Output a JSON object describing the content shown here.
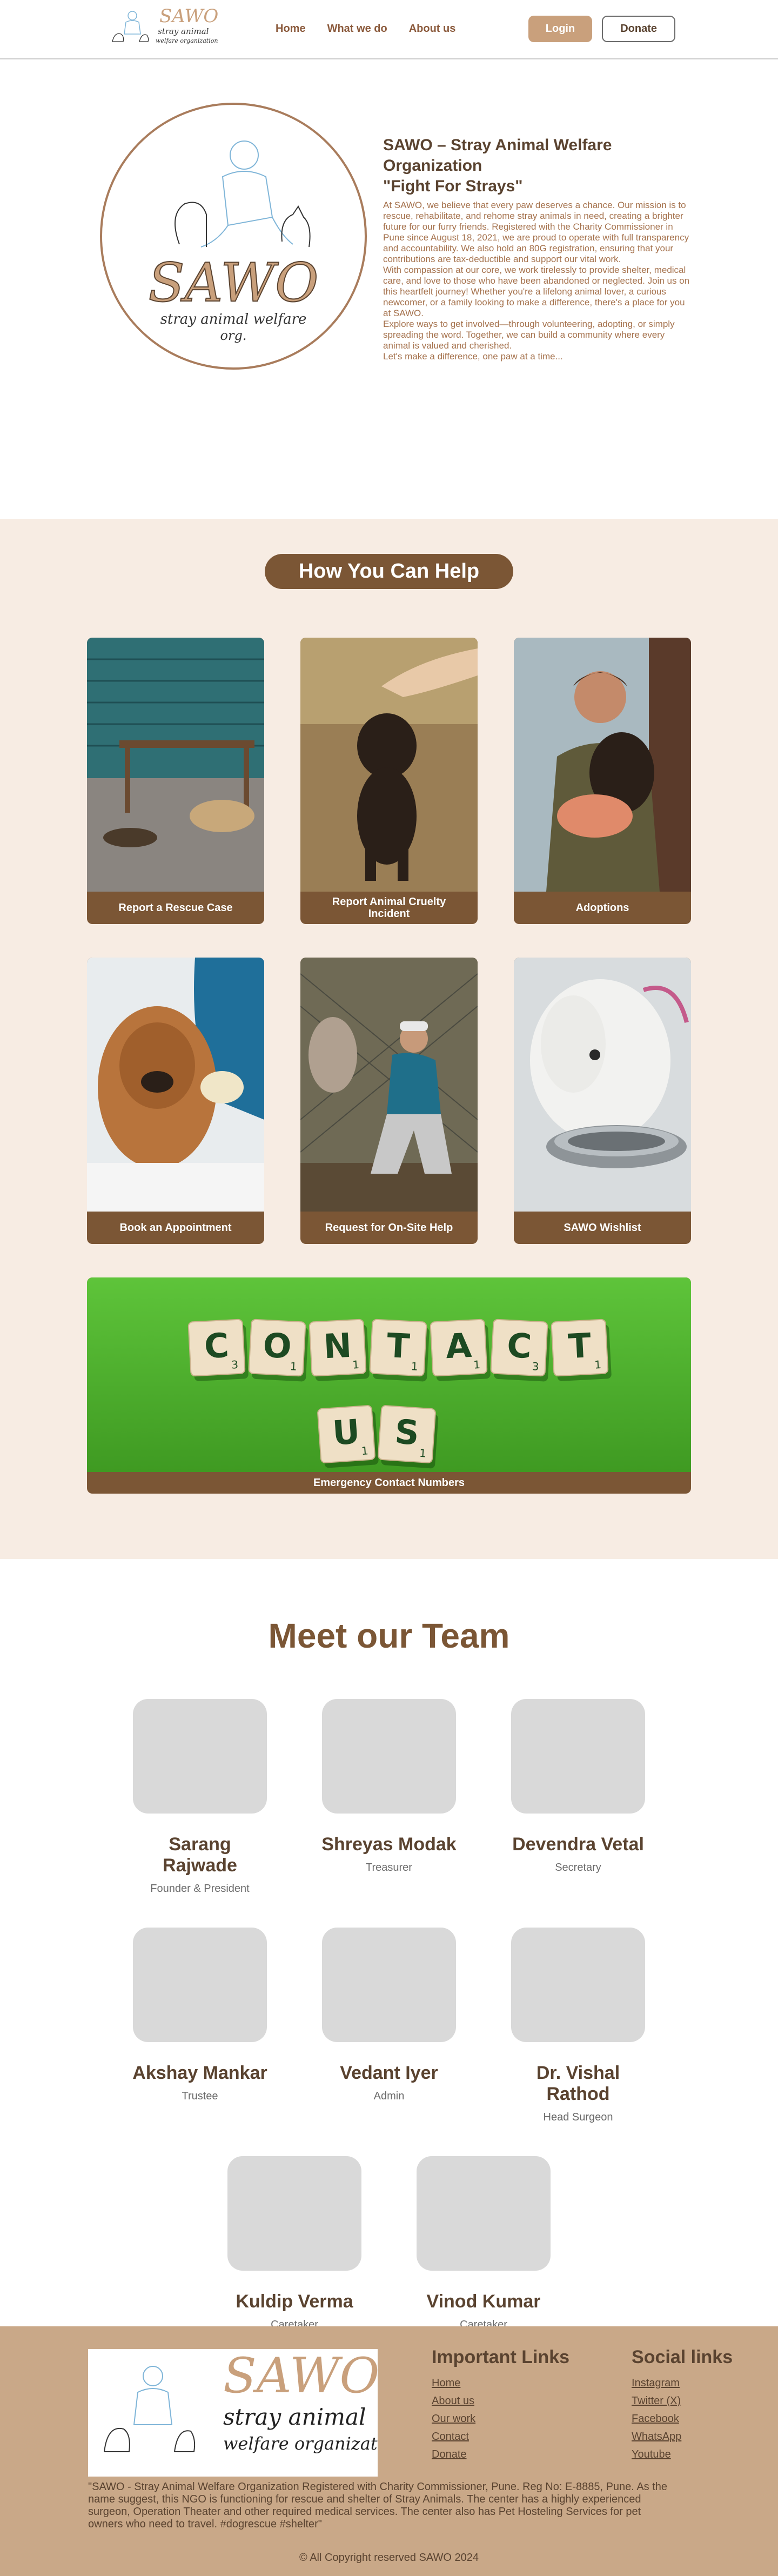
{
  "header": {
    "logo": {
      "title": "SAWO",
      "subtitle1": "stray animal",
      "subtitle2": "welfare organization"
    },
    "nav": [
      {
        "label": "Home"
      },
      {
        "label": "What we do"
      },
      {
        "label": "About us"
      }
    ],
    "login_label": "Login",
    "donate_label": "Donate"
  },
  "about": {
    "logo": {
      "title": "SAWO",
      "line1": "stray animal welfare",
      "line2": "org."
    },
    "title_line1": "SAWO – Stray Animal Welfare Organization",
    "title_line2": "\"Fight For Strays\"",
    "paragraphs": [
      "At SAWO, we believe that every paw deserves a chance. Our mission is to rescue, rehabilitate, and rehome stray animals in need, creating a brighter future for our furry friends. Registered with the Charity Commissioner in Pune since August 18, 2021, we are proud to operate with full transparency and accountability. We also hold an 80G registration, ensuring that your contributions are tax-deductible and support our vital work.",
      "With compassion at our core, we work tirelessly to provide shelter, medical care, and love to those who have been abandoned or neglected. Join us on this heartfelt journey! Whether you're a lifelong animal lover, a curious newcomer, or a family looking to make a difference, there's a place for you at SAWO.",
      "Explore ways to get involved—through volunteering, adopting, or simply spreading the word. Together, we can build a community where every animal is valued and cherished.",
      "Let's make a difference, one paw at a time..."
    ]
  },
  "services": {
    "heading": "How You Can Help",
    "cards": [
      {
        "label": "Report a Rescue Case"
      },
      {
        "label": "Report Animal Cruelty Incident"
      },
      {
        "label": "Adoptions"
      },
      {
        "label": "Book an Appointment"
      },
      {
        "label": "Request for On-Site Help"
      },
      {
        "label": "SAWO Wishlist"
      }
    ],
    "contact": {
      "label": "Emergency Contact Numbers",
      "tiles_row1": [
        {
          "letter": "C",
          "score": "3"
        },
        {
          "letter": "O",
          "score": "1"
        },
        {
          "letter": "N",
          "score": "1"
        },
        {
          "letter": "T",
          "score": "1"
        },
        {
          "letter": "A",
          "score": "1"
        },
        {
          "letter": "C",
          "score": "3"
        },
        {
          "letter": "T",
          "score": "1"
        }
      ],
      "tiles_row2": [
        {
          "letter": "U",
          "score": "1"
        },
        {
          "letter": "S",
          "score": "1"
        }
      ]
    }
  },
  "team": {
    "heading": "Meet our Team",
    "members": [
      {
        "name": "Sarang Rajwade",
        "role": "Founder & President"
      },
      {
        "name": "Shreyas Modak",
        "role": "Treasurer"
      },
      {
        "name": "Devendra Vetal",
        "role": "Secretary"
      },
      {
        "name": "Akshay Mankar",
        "role": "Trustee"
      },
      {
        "name": "Vedant Iyer",
        "role": "Admin"
      },
      {
        "name": "Dr. Vishal Rathod",
        "role": "Head Surgeon"
      },
      {
        "name": "Kuldip Verma",
        "role": "Caretaker"
      },
      {
        "name": "Vinod Kumar",
        "role": "Caretaker"
      }
    ]
  },
  "footer": {
    "logo": {
      "title": "SAWO",
      "line1": "stray animal",
      "line2": "welfare organization"
    },
    "important_links_heading": "Important Links",
    "important_links": [
      {
        "label": "Home"
      },
      {
        "label": "About us"
      },
      {
        "label": "Our work"
      },
      {
        "label": "Contact"
      },
      {
        "label": "Donate"
      }
    ],
    "social_heading": "Social links",
    "social_links": [
      {
        "label": "Instagram"
      },
      {
        "label": "Twitter (X)"
      },
      {
        "label": "Facebook"
      },
      {
        "label": "WhatsApp"
      },
      {
        "label": "Youtube"
      }
    ],
    "description": "\"SAWO - Stray Animal Welfare Organization Registered with Charity Commissioner, Pune. Reg No: E-8885, Pune. As the name suggest, this NGO is functioning for rescue and shelter of Stray Animals. The center has a highly experienced surgeon, Operation Theater and other required medical services. The center also has Pet Hosteling Services for pet owners who need to travel. #dogrescue #shelter\"",
    "copyright": "© All Copyright reserved SAWO 2024"
  },
  "colors": {
    "brand_brown": "#7b5635",
    "accent_tan": "#c9a07c",
    "section_bg": "#f7ece3",
    "footer_bg": "#c9a888"
  }
}
